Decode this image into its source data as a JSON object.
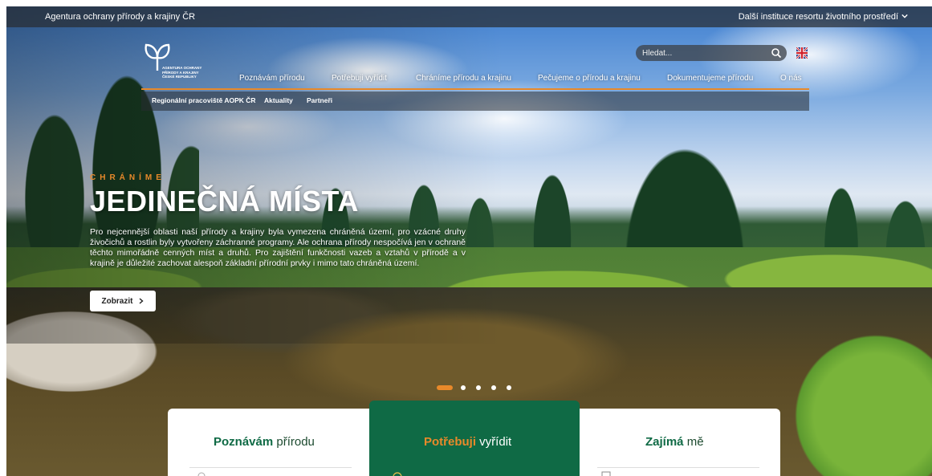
{
  "topbar": {
    "org_name": "Agentura ochrany přírody a krajiny ČR",
    "other_institutions": "Další instituce resortu životního prostředí"
  },
  "logo": {
    "lines": [
      "AGENTURA OCHRANY",
      "PŘÍRODY A KRAJINY",
      "ČESKÉ REPUBLIKY"
    ]
  },
  "search": {
    "placeholder": "Hledat..."
  },
  "main_nav": [
    {
      "label": "Poznávám přírodu"
    },
    {
      "label": "Potřebuji vyřídit"
    },
    {
      "label": "Chráníme přírodu a krajinu"
    },
    {
      "label": "Pečujeme o přírodu a krajinu"
    },
    {
      "label": "Dokumentujeme přírodu"
    },
    {
      "label": "O nás"
    }
  ],
  "sub_nav": [
    {
      "label": "Regionální pracoviště AOPK ČR"
    },
    {
      "label": "Aktuality"
    },
    {
      "label": "Partneři"
    }
  ],
  "hero": {
    "eyebrow": "CHRÁNÍME",
    "headline": "JEDINEČNÁ MÍSTA",
    "lead": "Pro nejcennější oblasti naší přírody a krajiny byla vymezena chráněná území, pro vzácné druhy živočichů a rostlin byly vytvořeny záchranné programy. Ale ochrana přírody nespočívá jen v ochraně těchto mimořádně cenných míst a druhů. Pro zajištění funkčnosti vazeb a vztahů v přírodě a v krajině je důležité zachovat alespoň základní přírodní prvky i mimo tato chráněná území.",
    "button_label": "Zobrazit"
  },
  "carousel": {
    "slides": 5,
    "active_index": 0
  },
  "cards": [
    {
      "bold": "Poznávám",
      "rest": " přírodu"
    },
    {
      "bold": "Potřebuji",
      "rest": " vyřídit"
    },
    {
      "bold": "Zajímá",
      "rest": " mě"
    }
  ],
  "colors": {
    "accent_orange": "#e8892a",
    "brand_green": "#0f6a45"
  }
}
